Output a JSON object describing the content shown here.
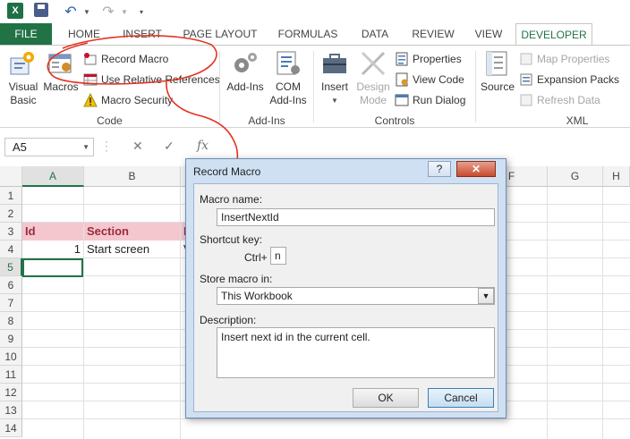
{
  "app": {
    "logo_text": "X"
  },
  "tabs": [
    "FILE",
    "HOME",
    "INSERT",
    "PAGE LAYOUT",
    "FORMULAS",
    "DATA",
    "REVIEW",
    "VIEW",
    "DEVELOPER"
  ],
  "ribbon": {
    "code": {
      "label": "Code",
      "visual_basic": "Visual\nBasic",
      "macros": "Macros",
      "record_macro": "Record Macro",
      "use_relative": "Use Relative References",
      "macro_security": "Macro Security"
    },
    "addins": {
      "label": "Add-Ins",
      "add_ins": "Add-Ins",
      "com_add_ins": "COM\nAdd-Ins"
    },
    "controls": {
      "label": "Controls",
      "insert": "Insert",
      "design_mode": "Design\nMode",
      "properties": "Properties",
      "view_code": "View Code",
      "run_dialog": "Run Dialog"
    },
    "xml": {
      "label": "XML",
      "source": "Source",
      "map_properties": "Map Properties",
      "expansion_packs": "Expansion Packs",
      "refresh_data": "Refresh Data"
    }
  },
  "formula_bar": {
    "name_box": "A5",
    "fx": "fx"
  },
  "sheet": {
    "columns": [
      "A",
      "B",
      "",
      "",
      "",
      "F",
      "G",
      "H"
    ],
    "rows": [
      "1",
      "2",
      "3",
      "4",
      "5",
      "6",
      "7",
      "8",
      "9",
      "10",
      "11",
      "12",
      "13",
      "14"
    ],
    "cells": {
      "a3": "Id",
      "b3": "Section",
      "c3": "D",
      "a4": "1",
      "b4": "Start screen",
      "c4": "V"
    }
  },
  "dialog": {
    "title": "Record Macro",
    "help": "?",
    "macro_name_label": "Macro name:",
    "macro_name_value": "InsertNextId",
    "shortcut_label": "Shortcut key:",
    "ctrl_label": "Ctrl+",
    "shortcut_value": "n",
    "store_label": "Store macro in:",
    "store_value": "This Workbook",
    "description_label": "Description:",
    "description_value": "Insert next id in the current cell.",
    "ok": "OK",
    "cancel": "Cancel"
  },
  "colors": {
    "excel_green": "#217346",
    "header_fill": "#f4c7ce",
    "header_text": "#9c2a3c",
    "annotation": "#e53322"
  }
}
